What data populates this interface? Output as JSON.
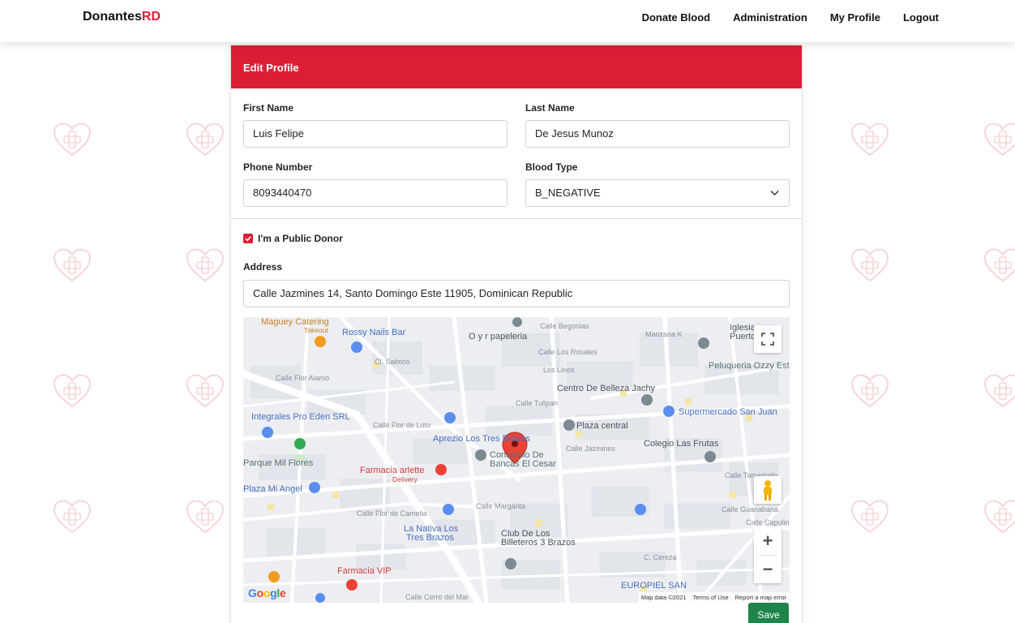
{
  "brand": {
    "part1": "Donantes",
    "part2": "RD"
  },
  "nav": {
    "donate": "Donate Blood",
    "admin": "Administration",
    "profile": "My Profile",
    "logout": "Logout"
  },
  "form": {
    "header": "Edit Profile",
    "first_name_label": "First Name",
    "first_name_value": "Luis Felipe",
    "last_name_label": "Last Name",
    "last_name_value": "De Jesus Munoz",
    "phone_label": "Phone Number",
    "phone_value": "8093440470",
    "blood_label": "Blood Type",
    "blood_value": "B_NEGATIVE",
    "public_donor_label": "I'm a Public Donor",
    "public_donor_checked": true,
    "address_label": "Address",
    "address_value": "Calle Jazmines 14, Santo Domingo Este 11905, Dominican Republic",
    "save_label": "Save"
  },
  "map": {
    "labels": {
      "maguey": "Maguey Catering",
      "takeout": "Takeout",
      "rossy": "Rossy Nails Bar",
      "papeleria": "O y r papeleria",
      "iglesia": "Iglesia",
      "puerto": "Puerto",
      "peluqueria": "Peluqueria Ozzy Estilo",
      "centro": "Centro De Belleza Jachy",
      "integrales": "Integrales Pro Eden SRL",
      "supermercado": "Supermercado San Juan",
      "plaza_central": "Plaza central",
      "aprezio": "Aprezio Los Tres Brazos",
      "colegio": "Colegio Las Frutas",
      "consorcio1": "Consorcio De",
      "consorcio2": "Bancas El Cesar",
      "parque": "Parque Mil Flores",
      "farmacia_arlette": "Farmacia arlette",
      "delivery": "Delivery",
      "plaza_angel": "Plaza Mi Angel",
      "nativa1": "La Nativa Los",
      "nativa2": "Tres Brazos",
      "club1": "Club De Los",
      "club2": "Billeteros 3 Brazos",
      "farmacia_vip": "Farmacia VIP",
      "europiel": "EUROPIEL SAN"
    },
    "streets": {
      "begonias": "Calle Begonias",
      "manzana": "Manzana K",
      "rosales": "Calle Los Rosales",
      "linos": "Los Linos",
      "tulipan": "Calle Tulipan",
      "flor_alamo": "Calle Flor Alamo",
      "salmos": "Cl. Salmos",
      "flor_loto": "Calle Flor de Loto",
      "jazmines": "Calle Jazmines",
      "tamarindo": "Calle Tamarindo",
      "guanabana": "Calle Guanabana",
      "capulin": "Calle Capulin",
      "margarita": "Calle Margarita",
      "camelia": "Calle Flor de Camelia",
      "cereza": "C. Cereza",
      "cerro": "Calle Cerro del Mar"
    },
    "google": "Google",
    "attribution": {
      "data": "Map data ©2021",
      "terms": "Terms of Use",
      "report": "Report a map error"
    }
  },
  "colors": {
    "brand_red": "#dc1e35",
    "save_green": "#1e8449"
  },
  "icons": [
    "heart-plus-icon",
    "checkbox-checked-icon",
    "chevron-down-icon",
    "fullscreen-icon",
    "pegman-icon",
    "map-pin-icon"
  ]
}
